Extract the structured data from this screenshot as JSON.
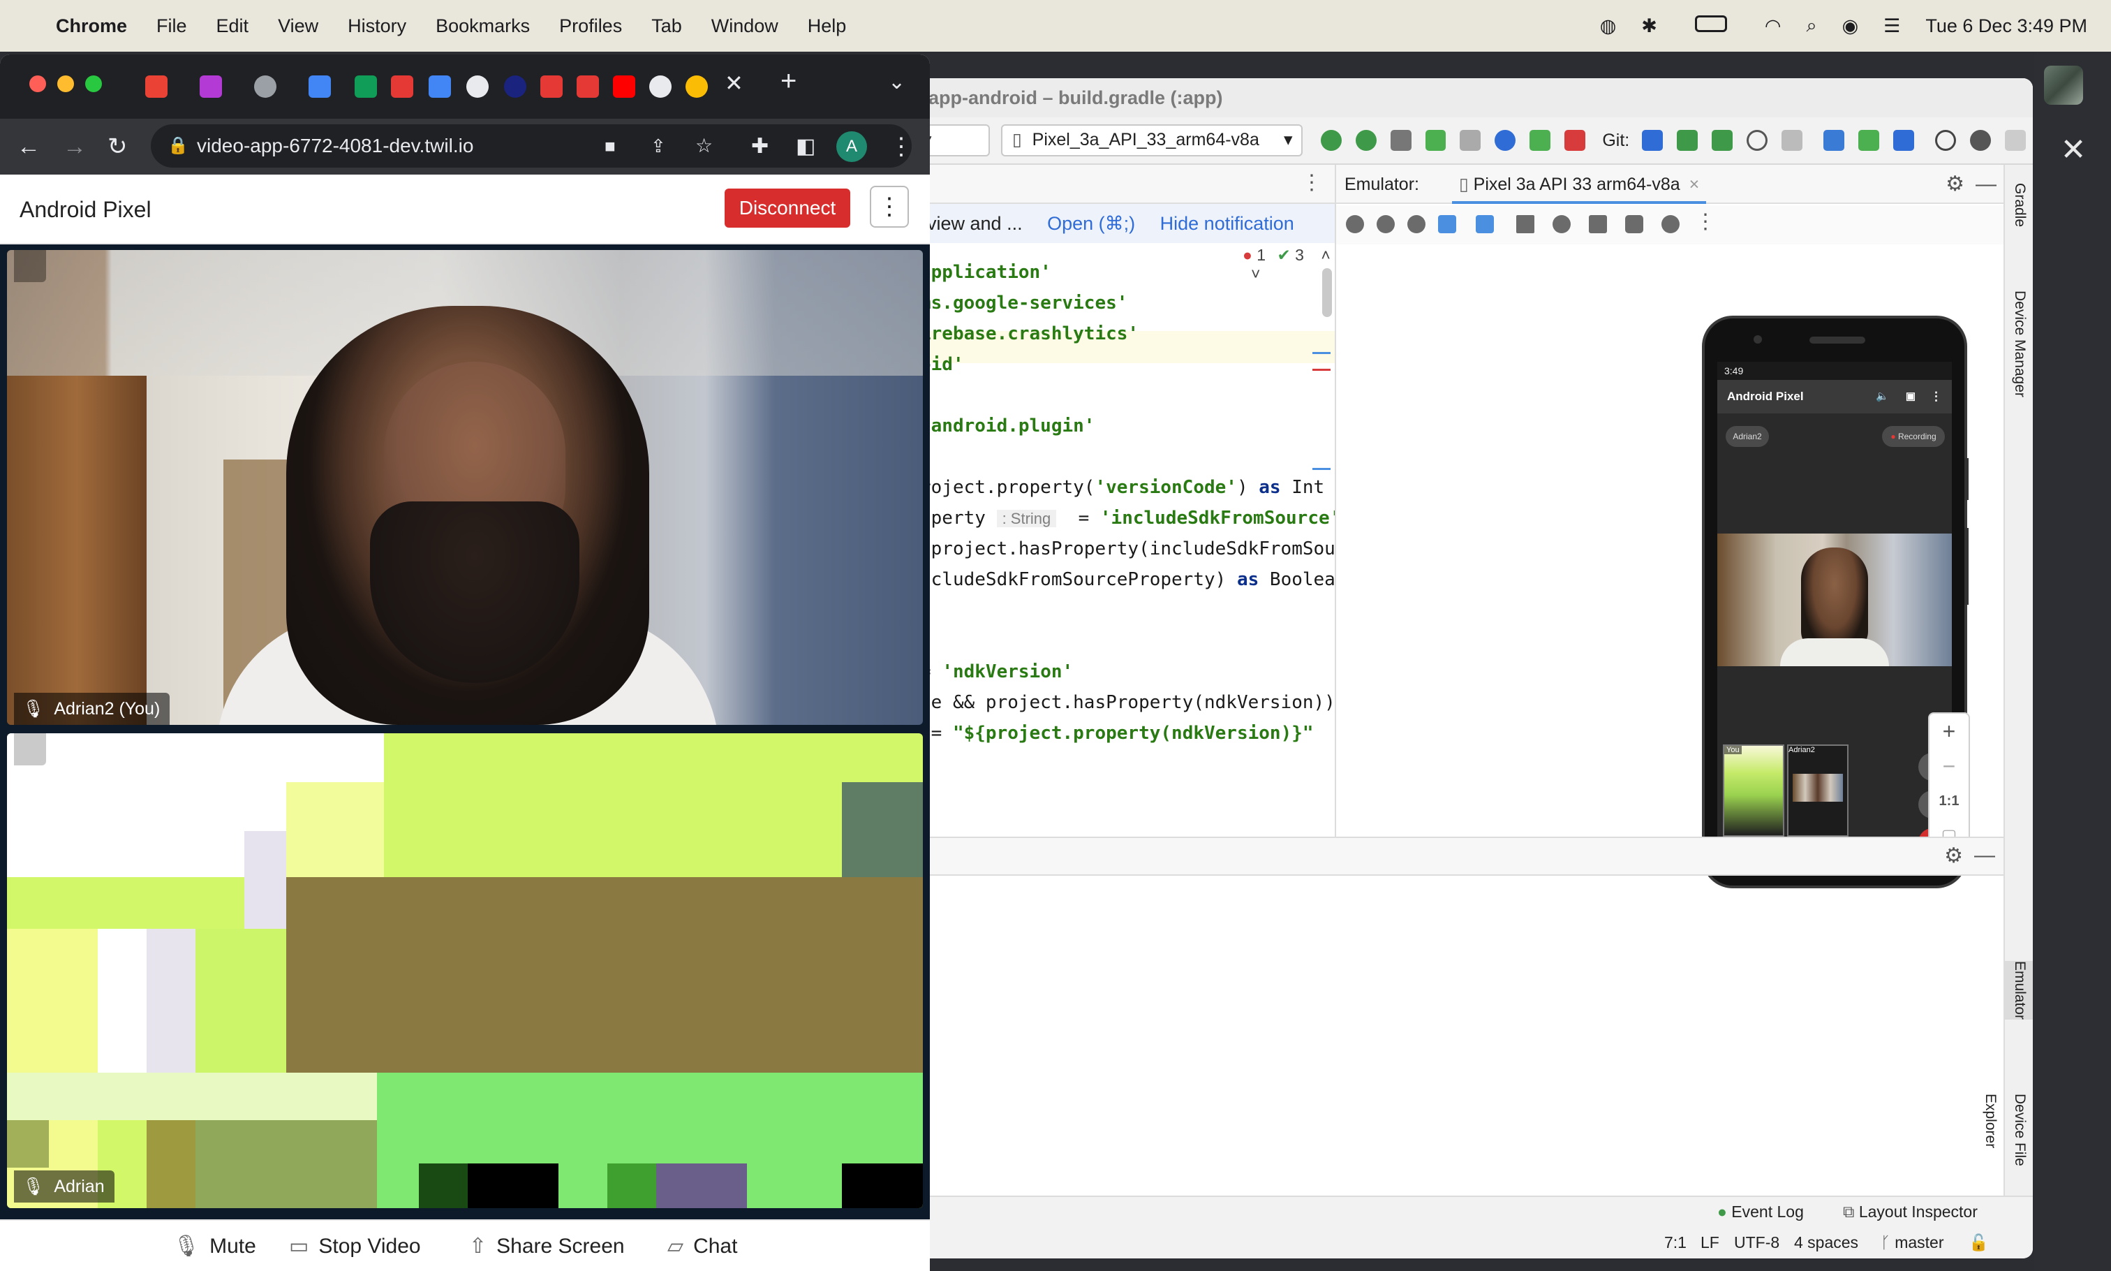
{
  "menubar": {
    "app": "Chrome",
    "items": [
      "File",
      "Edit",
      "View",
      "History",
      "Bookmarks",
      "Profiles",
      "Tab",
      "Window",
      "Help"
    ],
    "clock": "Tue 6 Dec  3:49 PM"
  },
  "studio": {
    "title": "app-android – build.gradle (:app)",
    "device_combo": "Pixel_3a_API_33_arm64-v8a",
    "git_label": "Git:",
    "notification": {
      "text": "view and ...",
      "open": "Open (⌘;)",
      "hide": "Hide notification"
    },
    "inspection": {
      "errors": "1",
      "warnings": "3"
    },
    "code_lines": [
      {
        "parts": [
          {
            "t": "application'",
            "c": "str"
          }
        ]
      },
      {
        "parts": [
          {
            "t": "ms.google-services'",
            "c": "str"
          }
        ]
      },
      {
        "parts": [
          {
            "t": "irebase.crashlytics'",
            "c": "str"
          }
        ]
      },
      {
        "parts": [
          {
            "t": "oid'",
            "c": "str"
          }
        ]
      },
      {
        "parts": []
      },
      {
        "parts": [
          {
            "t": " android.plugin'",
            "c": "str"
          }
        ]
      },
      {
        "parts": []
      },
      {
        "parts": [
          {
            "t": "roject.property(",
            "c": ""
          },
          {
            "t": "'versionCode'",
            "c": "str"
          },
          {
            "t": ") ",
            "c": ""
          },
          {
            "t": "as",
            "c": "kw"
          },
          {
            "t": " Int",
            "c": ""
          }
        ]
      },
      {
        "parts": [
          {
            "t": "operty ",
            "c": ""
          },
          {
            "t": ": String",
            "c": "hint"
          },
          {
            "t": "  = ",
            "c": ""
          },
          {
            "t": "'includeSdkFromSource'",
            "c": "str"
          }
        ]
      },
      {
        "parts": [
          {
            "t": " project.hasProperty(includeSdkFromSou",
            "c": ""
          }
        ]
      },
      {
        "parts": [
          {
            "t": "ncludeSdkFromSourceProperty) ",
            "c": ""
          },
          {
            "t": "as",
            "c": "kw"
          },
          {
            "t": " Boolea",
            "c": ""
          }
        ]
      },
      {
        "parts": []
      },
      {
        "parts": []
      },
      {
        "parts": [
          {
            "t": "= ",
            "c": ""
          },
          {
            "t": "'ndkVersion'",
            "c": "str"
          }
        ]
      },
      {
        "parts": [
          {
            "t": "ce && project.hasProperty(ndkVersion))",
            "c": ""
          }
        ]
      },
      {
        "parts": [
          {
            "t": " = ",
            "c": ""
          },
          {
            "t": "\"${project.property(ndkVersion)}\"",
            "c": "str"
          }
        ]
      }
    ],
    "emulator": {
      "label": "Emulator:",
      "device_tab": "Pixel 3a API 33 arm64-v8a",
      "zoom_ratio": "1:1"
    },
    "phone": {
      "time": "3:49",
      "room": "Android Pixel",
      "chip_user": "Adrian2",
      "chip_recording": "Recording",
      "thumb_you": "You",
      "thumb_adrian2": "Adrian2"
    },
    "bottom_partial": "er",
    "status": {
      "event_log": "Event Log",
      "layout_inspector": "Layout Inspector",
      "position": "7:1",
      "line_sep": "LF",
      "encoding": "UTF-8",
      "indent": "4 spaces",
      "branch": "master"
    },
    "rail": [
      "Gradle",
      "Device Manager",
      "Emulator",
      "Device File Explorer"
    ]
  },
  "chrome": {
    "url": "video-app-6772-4081-dev.twil.io",
    "profile_initial": "A",
    "room_name": "Android Pixel",
    "disconnect_label": "Disconnect",
    "participants": [
      {
        "name": "Adrian2 (You)"
      },
      {
        "name": "Adrian"
      }
    ],
    "footer": {
      "mute": "Mute",
      "stop_video": "Stop Video",
      "share_screen": "Share Screen",
      "chat": "Chat"
    }
  },
  "colors": {
    "disconnect": "#d82d2d",
    "link_blue": "#2f6cd6",
    "string_green": "#2a7a14",
    "tile_green": "#d2f86a"
  }
}
